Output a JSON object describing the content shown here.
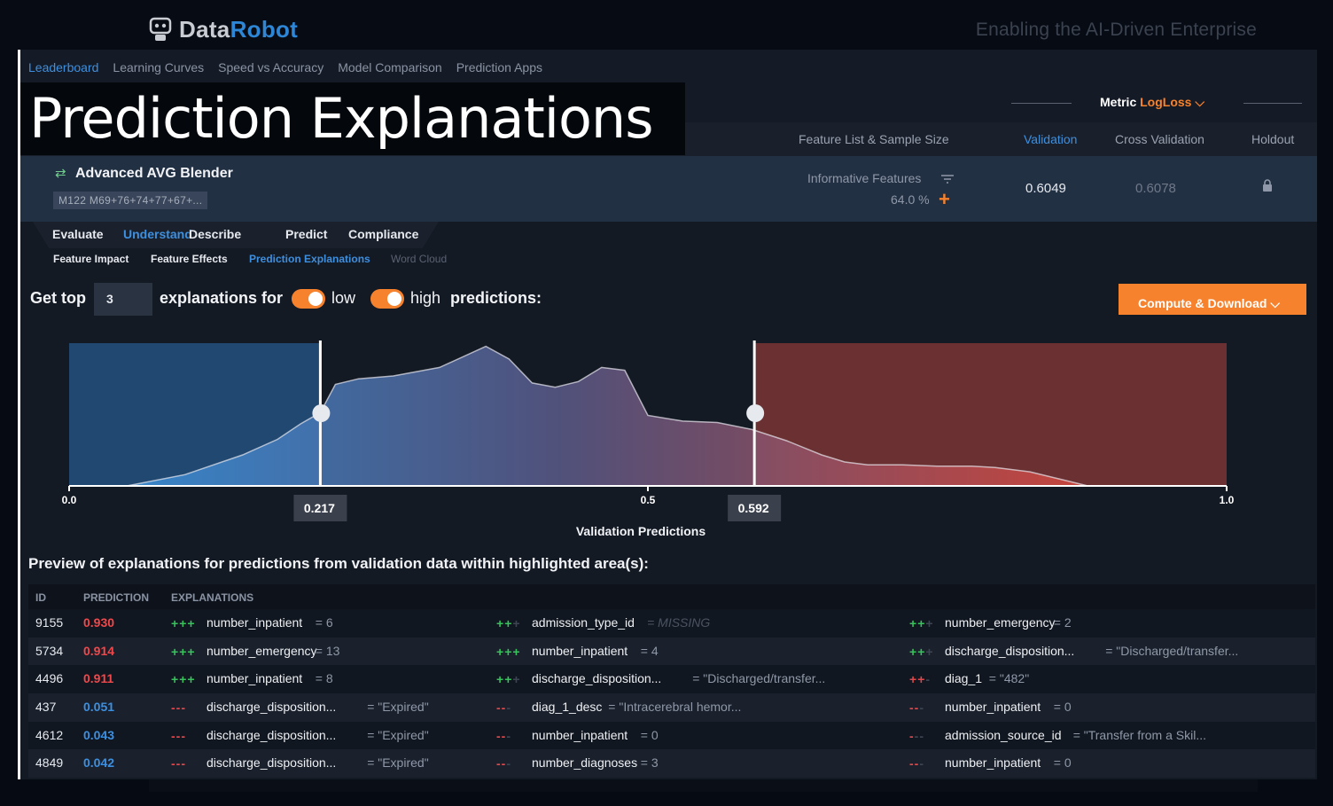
{
  "branding": {
    "logo_a": "Data",
    "logo_b": "Robot",
    "tagline": "Enabling the AI-Driven Enterprise"
  },
  "nav": [
    "Leaderboard",
    "Learning Curves",
    "Speed vs Accuracy",
    "Model Comparison",
    "Prediction Apps"
  ],
  "overlay_title": "Prediction Explanations",
  "toolbar": {
    "metric_label": "Metric",
    "metric_value": "LogLoss"
  },
  "columns": {
    "feature_list": "Feature List & Sample Size",
    "validation": "Validation",
    "cross_validation": "Cross Validation",
    "holdout": "Holdout"
  },
  "model": {
    "name": "Advanced AVG Blender",
    "tag": "M122  M69+76+74+77+67+...",
    "feature_list": "Informative Features",
    "sample_pct": "64.0 %",
    "validation": "0.6049",
    "cross_validation": "0.6078"
  },
  "tabs": [
    "Evaluate",
    "Understand",
    "Describe",
    "Predict",
    "Compliance"
  ],
  "subtabs": [
    "Feature Impact",
    "Feature Effects",
    "Prediction Explanations",
    "Word Cloud"
  ],
  "controls": {
    "get_top": "Get top",
    "top_n": "3",
    "explanations_for": "explanations for",
    "low": "low",
    "high": "high",
    "predictions": "predictions:",
    "compute_button": "Compute & Download"
  },
  "chart_data": {
    "type": "area",
    "xlabel": "Validation Predictions",
    "xlim": [
      0.0,
      1.0
    ],
    "tick_labels": [
      "0.0",
      "0.5",
      "1.0"
    ],
    "thresholds": {
      "low": 0.217,
      "high": 0.592
    },
    "threshold_labels": [
      "0.217",
      "0.592"
    ],
    "x": [
      0.05,
      0.1,
      0.15,
      0.18,
      0.2,
      0.217,
      0.23,
      0.25,
      0.28,
      0.32,
      0.36,
      0.38,
      0.4,
      0.42,
      0.44,
      0.46,
      0.48,
      0.5,
      0.53,
      0.56,
      0.59,
      0.62,
      0.65,
      0.67,
      0.69,
      0.72,
      0.75,
      0.78,
      0.8,
      0.83,
      0.86,
      0.88
    ],
    "density": [
      0.0,
      0.08,
      0.22,
      0.33,
      0.44,
      0.52,
      0.72,
      0.76,
      0.78,
      0.84,
      0.99,
      0.9,
      0.73,
      0.7,
      0.74,
      0.84,
      0.82,
      0.5,
      0.46,
      0.45,
      0.4,
      0.32,
      0.22,
      0.17,
      0.15,
      0.15,
      0.14,
      0.14,
      0.13,
      0.1,
      0.04,
      0.0
    ]
  },
  "preview_title": "Preview of explanations for predictions from validation data within highlighted area(s):",
  "table": {
    "headers": [
      "ID",
      "PREDICTION",
      "EXPLANATIONS"
    ],
    "rows": [
      {
        "id": "9155",
        "prediction": "0.930",
        "level": "hi",
        "explanations": [
          {
            "sign": [
              "g",
              "g",
              "g"
            ],
            "feature": "number_inpatient",
            "value": "= 6"
          },
          {
            "sign": [
              "g",
              "g",
              "d"
            ],
            "feature": "admission_type_id",
            "value": "= MISSING",
            "missing": true
          },
          {
            "sign": [
              "g",
              "g",
              "d"
            ],
            "feature": "number_emergency",
            "value": "= 2"
          }
        ]
      },
      {
        "id": "5734",
        "prediction": "0.914",
        "level": "hi",
        "explanations": [
          {
            "sign": [
              "g",
              "g",
              "g"
            ],
            "feature": "number_emergency",
            "value": "= 13"
          },
          {
            "sign": [
              "g",
              "g",
              "g"
            ],
            "feature": "number_inpatient",
            "value": "= 4"
          },
          {
            "sign": [
              "g",
              "g",
              "d"
            ],
            "feature": "discharge_disposition...",
            "value": "= \"Discharged/transfer..."
          }
        ]
      },
      {
        "id": "4496",
        "prediction": "0.911",
        "level": "hi",
        "explanations": [
          {
            "sign": [
              "g",
              "g",
              "g"
            ],
            "feature": "number_inpatient",
            "value": "= 8"
          },
          {
            "sign": [
              "g",
              "g",
              "d"
            ],
            "feature": "discharge_disposition...",
            "value": "= \"Discharged/transfer..."
          },
          {
            "sign": [
              "r",
              "r",
              "d"
            ],
            "feature": "diag_1",
            "value": "= \"482\""
          }
        ]
      },
      {
        "id": "437",
        "prediction": "0.051",
        "level": "lo",
        "explanations": [
          {
            "sign": [
              "r",
              "r",
              "r"
            ],
            "feature": "discharge_disposition...",
            "value": "= \"Expired\""
          },
          {
            "sign": [
              "r",
              "r",
              "d"
            ],
            "feature": "diag_1_desc",
            "value": "= \"Intracerebral hemor..."
          },
          {
            "sign": [
              "r",
              "r",
              "d"
            ],
            "feature": "number_inpatient",
            "value": "= 0"
          }
        ]
      },
      {
        "id": "4612",
        "prediction": "0.043",
        "level": "lo",
        "explanations": [
          {
            "sign": [
              "r",
              "r",
              "r"
            ],
            "feature": "discharge_disposition...",
            "value": "= \"Expired\""
          },
          {
            "sign": [
              "r",
              "r",
              "d"
            ],
            "feature": "number_inpatient",
            "value": "= 0"
          },
          {
            "sign": [
              "r",
              "d",
              "d"
            ],
            "feature": "admission_source_id",
            "value": "= \"Transfer from a Skil..."
          }
        ]
      },
      {
        "id": "4849",
        "prediction": "0.042",
        "level": "lo",
        "explanations": [
          {
            "sign": [
              "r",
              "r",
              "r"
            ],
            "feature": "discharge_disposition...",
            "value": "= \"Expired\""
          },
          {
            "sign": [
              "r",
              "r",
              "d"
            ],
            "feature": "number_diagnoses",
            "value": "= 3"
          },
          {
            "sign": [
              "r",
              "r",
              "d"
            ],
            "feature": "number_inpatient",
            "value": "= 0"
          }
        ]
      }
    ]
  },
  "colors": {
    "accent": "#f7822d",
    "link": "#3d8fe0",
    "low_region": "#2c7fc8",
    "high_region": "#c0423c"
  }
}
